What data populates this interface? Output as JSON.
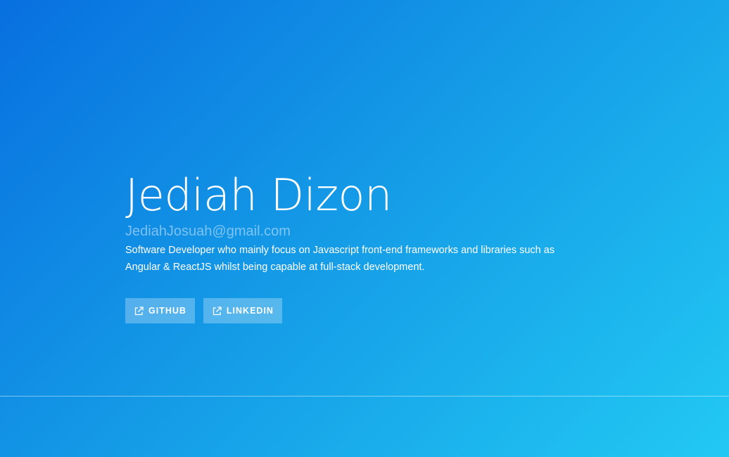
{
  "hero": {
    "name": "Jediah Dizon",
    "email": "JediahJosuah@gmail.com",
    "bio": "Software Developer who mainly focus on Javascript front-end frameworks and libraries such as Angular & ReactJS whilst being capable at full-stack development."
  },
  "links": [
    {
      "label": "GITHUB",
      "icon": "external-link-icon"
    },
    {
      "label": "LINKEDIN",
      "icon": "external-link-icon"
    }
  ],
  "colors": {
    "gradient_start": "#0870e0",
    "gradient_mid": "#1499e6",
    "gradient_end": "#22c9f3",
    "text": "#ffffff"
  }
}
